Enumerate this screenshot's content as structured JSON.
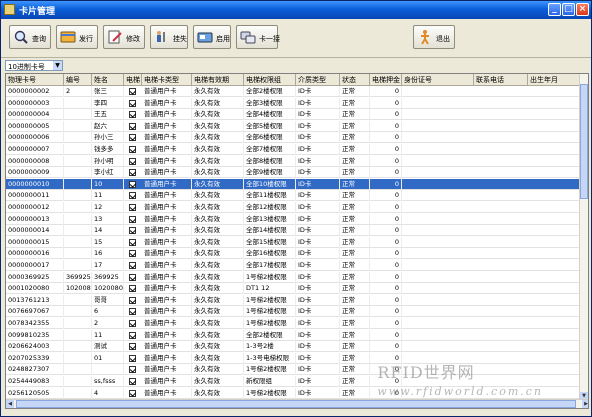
{
  "window": {
    "title": "卡片管理"
  },
  "toolbar": {
    "buttons": [
      {
        "label": "查询",
        "icon": "search-icon"
      },
      {
        "label": "发行",
        "icon": "issue-card-icon"
      },
      {
        "label": "修改",
        "icon": "edit-icon"
      },
      {
        "label": "挂失",
        "icon": "report-loss-icon"
      },
      {
        "label": "启用",
        "icon": "enable-icon"
      },
      {
        "label": "卡一接",
        "icon": "card-link-icon"
      },
      {
        "label": "退出",
        "icon": "exit-icon"
      }
    ]
  },
  "filter": {
    "value": "10进制卡号"
  },
  "table": {
    "columns": [
      "物理卡号",
      "编号",
      "姓名",
      "电梯",
      "电梯卡类型",
      "电梯有效期",
      "电梯权限组",
      "介质类型",
      "状态",
      "电梯押金",
      "身份证号",
      "联系电话",
      "出生年月"
    ],
    "rows": [
      [
        "0000000002",
        "2",
        "张三",
        "普通用户卡",
        "永久有效",
        "全部2楼权限",
        "ID卡",
        "正常",
        "0"
      ],
      [
        "0000000003",
        "",
        "李四",
        "普通用户卡",
        "永久有效",
        "全部3楼权限",
        "ID卡",
        "正常",
        "0"
      ],
      [
        "0000000004",
        "",
        "王五",
        "普通用户卡",
        "永久有效",
        "全部4楼权限",
        "ID卡",
        "正常",
        "0"
      ],
      [
        "0000000005",
        "",
        "赵六",
        "普通用户卡",
        "永久有效",
        "全部5楼权限",
        "ID卡",
        "正常",
        "0"
      ],
      [
        "0000000006",
        "",
        "孙小三",
        "普通用户卡",
        "永久有效",
        "全部6楼权限",
        "ID卡",
        "正常",
        "0"
      ],
      [
        "0000000007",
        "",
        "钱多多",
        "普通用户卡",
        "永久有效",
        "全部7楼权限",
        "ID卡",
        "正常",
        "0"
      ],
      [
        "0000000008",
        "",
        "孙小明",
        "普通用户卡",
        "永久有效",
        "全部8楼权限",
        "ID卡",
        "正常",
        "0"
      ],
      [
        "0000000009",
        "",
        "李小红",
        "普通用户卡",
        "永久有效",
        "全部9楼权限",
        "ID卡",
        "正常",
        "0"
      ],
      [
        "0000000010",
        "",
        "10",
        "普通用户卡",
        "永久有效",
        "全部10楼权限",
        "ID卡",
        "正常",
        "0"
      ],
      [
        "0000000011",
        "",
        "11",
        "普通用户卡",
        "永久有效",
        "全部11楼权限",
        "ID卡",
        "正常",
        "0"
      ],
      [
        "0000000012",
        "",
        "12",
        "普通用户卡",
        "永久有效",
        "全部12楼权限",
        "ID卡",
        "正常",
        "0"
      ],
      [
        "0000000013",
        "",
        "13",
        "普通用户卡",
        "永久有效",
        "全部13楼权限",
        "ID卡",
        "正常",
        "0"
      ],
      [
        "0000000014",
        "",
        "14",
        "普通用户卡",
        "永久有效",
        "全部14楼权限",
        "ID卡",
        "正常",
        "0"
      ],
      [
        "0000000015",
        "",
        "15",
        "普通用户卡",
        "永久有效",
        "全部15楼权限",
        "ID卡",
        "正常",
        "0"
      ],
      [
        "0000000016",
        "",
        "16",
        "普通用户卡",
        "永久有效",
        "全部16楼权限",
        "ID卡",
        "正常",
        "0"
      ],
      [
        "0000000017",
        "",
        "17",
        "普通用户卡",
        "永久有效",
        "全部17楼权限",
        "ID卡",
        "正常",
        "0"
      ],
      [
        "0000369925",
        "369925",
        "369925",
        "普通用户卡",
        "永久有效",
        "1号梯2楼权限",
        "ID卡",
        "正常",
        "0"
      ],
      [
        "0001020080",
        "1020080",
        "1020080",
        "普通用户卡",
        "永久有效",
        "DT1 12",
        "ID卡",
        "正常",
        "0"
      ],
      [
        "0013761213",
        "",
        "哥哥",
        "普通用户卡",
        "永久有效",
        "1号梯2楼权限",
        "ID卡",
        "正常",
        "0"
      ],
      [
        "0076697067",
        "",
        "6",
        "普通用户卡",
        "永久有效",
        "1号梯2楼权限",
        "ID卡",
        "正常",
        "0"
      ],
      [
        "0078342355",
        "",
        "2",
        "普通用户卡",
        "永久有效",
        "1号梯2楼权限",
        "ID卡",
        "正常",
        "0"
      ],
      [
        "0099810235",
        "",
        "11",
        "普通用户卡",
        "永久有效",
        "全部2楼权限",
        "ID卡",
        "正常",
        "0"
      ],
      [
        "0206624003",
        "",
        "测试",
        "普通用户卡",
        "永久有效",
        "1-3号2楼",
        "ID卡",
        "正常",
        "0"
      ],
      [
        "0207025339",
        "",
        "01",
        "普通用户卡",
        "永久有效",
        "1-3号电梯权限",
        "ID卡",
        "正常",
        "0"
      ],
      [
        "0248827307",
        "",
        "",
        "普通用户卡",
        "永久有效",
        "1号梯2楼权限",
        "ID卡",
        "正常",
        "0"
      ],
      [
        "0254449083",
        "",
        "ss,fsss",
        "普通用户卡",
        "永久有效",
        "新权限组",
        "ID卡",
        "正常",
        "0"
      ],
      [
        "0256120505",
        "",
        "4",
        "普通用户卡",
        "永久有效",
        "1号梯2楼权限",
        "ID卡",
        "正常",
        "0"
      ]
    ],
    "selected_row": 8
  },
  "watermark": {
    "line1": "RFID世界网",
    "line2": "www.rfidworld.com.cn"
  }
}
